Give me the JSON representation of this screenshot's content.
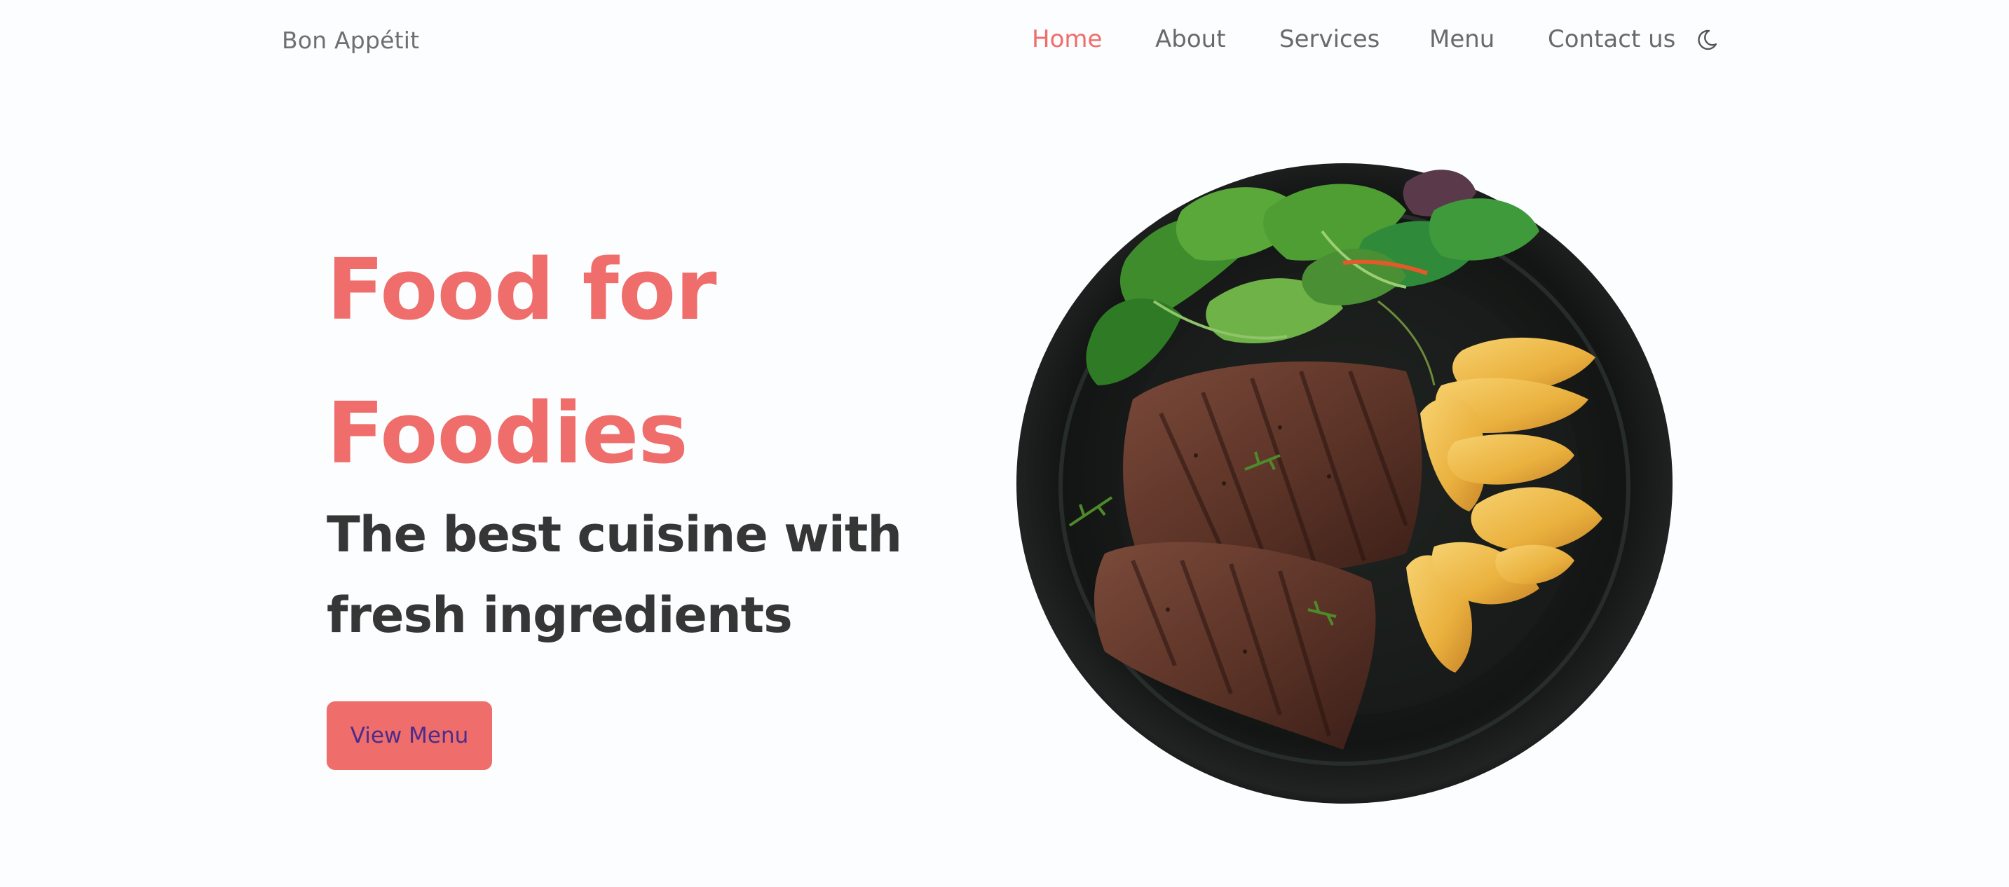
{
  "header": {
    "brand": "Bon Appétit",
    "nav": [
      {
        "label": "Home",
        "active": true
      },
      {
        "label": "About",
        "active": false
      },
      {
        "label": "Services",
        "active": false
      },
      {
        "label": "Menu",
        "active": false
      },
      {
        "label": "Contact us",
        "active": false
      }
    ],
    "theme_toggle_icon": "moon-icon"
  },
  "hero": {
    "title_line1": "Food for",
    "title_line2": "Foodies",
    "subtitle_line1": "The best cuisine with",
    "subtitle_line2": "fresh ingredients",
    "button_label": "View Menu",
    "image": "steak-with-potato-wedges-and-salad-plate"
  },
  "colors": {
    "accent": "#ef6d6a",
    "heading_dark": "#363636",
    "nav_text": "#6a6a6a",
    "button_text": "#4b2c8c",
    "background": "#fcfdfe"
  }
}
